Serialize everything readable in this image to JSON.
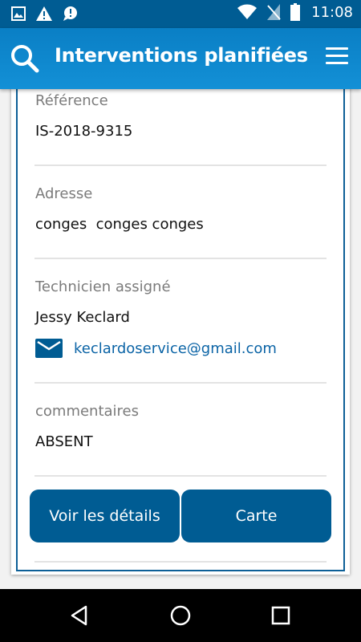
{
  "status_bar": {
    "time": "11:08",
    "left_icons": [
      "image-icon",
      "warning-icon",
      "chat-alert-icon"
    ],
    "right_icons": [
      "wifi-icon",
      "no-sim-icon",
      "battery-icon"
    ]
  },
  "app_bar": {
    "title": "Interventions planifiées",
    "search_icon": "search-icon",
    "menu_icon": "menu-icon"
  },
  "detail": {
    "reference_label": "Référence",
    "reference_value": "IS-2018-9315",
    "address_label": "Adresse",
    "address_value": "conges  conges conges",
    "technician_label": "Technicien assigné",
    "technician_name": "Jessy Keclard",
    "technician_email": "keclardoservice@gmail.com",
    "comments_label": "commentaires",
    "comments_value": "ABSENT"
  },
  "actions": {
    "details_label": "Voir les détails",
    "map_label": "Carte"
  },
  "nav": [
    "back-icon",
    "home-icon",
    "recents-icon"
  ],
  "colors": {
    "primary": "#005c93",
    "app_bar": "#1390d6",
    "link": "#0b64a6",
    "label": "#7b7b7b"
  }
}
